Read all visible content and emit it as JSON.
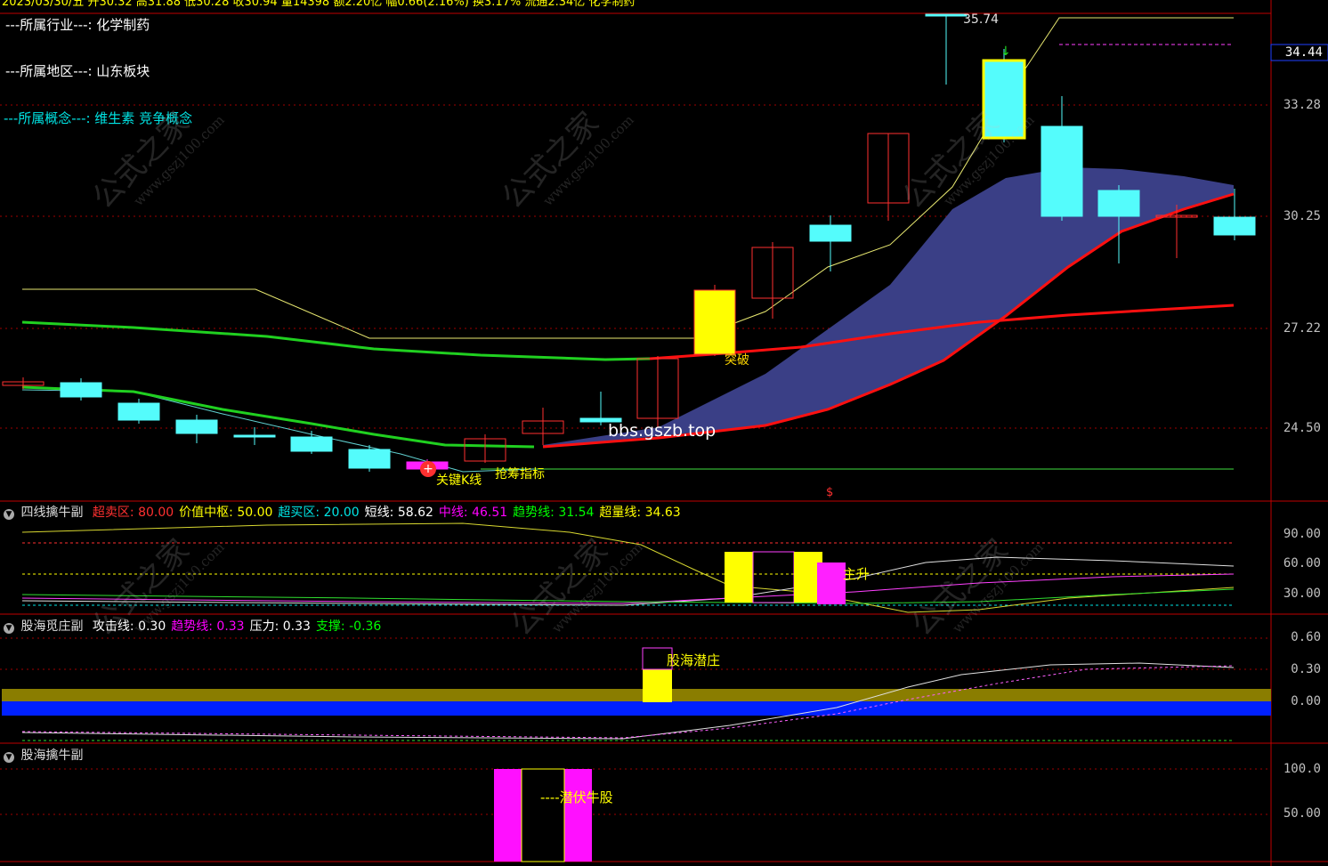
{
  "header": {
    "partial_text": "2023/03/30/五 开30.32 高31.88 低30.28 收30.94 量14398 额2.20亿 幅0.66(2.16%) 换3.17% 流通2.34亿 化学制药"
  },
  "info_lines": [
    {
      "text": "---所属行业---: 化学制药",
      "color": "#ffffff"
    },
    {
      "text": "---所属地区---: 山东板块",
      "color": "#ffffff"
    },
    {
      "text": "---所属概念---: 维生素 竞争概念",
      "color": "#00e5e5"
    }
  ],
  "main_axis": [
    "34.44",
    "33.28",
    "30.25",
    "27.22",
    "24.50"
  ],
  "price_annotations": {
    "high": "35.74",
    "low_marker": "$",
    "breakout": "突破",
    "key_line": "关键K线",
    "grab_chip": "抢筹指标",
    "watermark_url": "bbs.gszb.top"
  },
  "panel1": {
    "name": "四线擒牛副",
    "items": [
      {
        "label": "超卖区: ",
        "value": "80.00",
        "color": "#ff3030"
      },
      {
        "label": "价值中枢: ",
        "value": "50.00",
        "color": "#ffff00"
      },
      {
        "label": "超买区: ",
        "value": "20.00",
        "color": "#00e5e5"
      },
      {
        "label": "短线: ",
        "value": "58.62",
        "color": "#ffffff"
      },
      {
        "label": "中线: ",
        "value": "46.51",
        "color": "#ff00ff"
      },
      {
        "label": "趋势线: ",
        "value": "31.54",
        "color": "#00ff00"
      },
      {
        "label": "超量线: ",
        "value": "34.63",
        "color": "#ffff00"
      }
    ],
    "axis": [
      "90.00",
      "60.00",
      "30.00"
    ],
    "signal": "主升"
  },
  "panel2": {
    "name": "股海觅庄副",
    "items": [
      {
        "label": "攻击线: ",
        "value": "0.30",
        "color": "#ffffff"
      },
      {
        "label": "趋势线: ",
        "value": "0.33",
        "color": "#ff00ff"
      },
      {
        "label": "压力: ",
        "value": "0.33",
        "color": "#ffffff"
      },
      {
        "label": "支撑: ",
        "value": "-0.36",
        "color": "#00ff00"
      }
    ],
    "axis": [
      "0.60",
      "0.30",
      "0.00"
    ],
    "signal": "股海潜庄"
  },
  "panel3": {
    "name": "股海擒牛副",
    "axis": [
      "100.0",
      "50.00"
    ],
    "signal": "----潜伏牛股"
  },
  "watermark": {
    "cn": "公式之家",
    "url": "www.gszj100.com"
  },
  "colors": {
    "up": "#ff3030",
    "down": "#54fcfc",
    "background": "#000000",
    "grid": "#a00000"
  }
}
